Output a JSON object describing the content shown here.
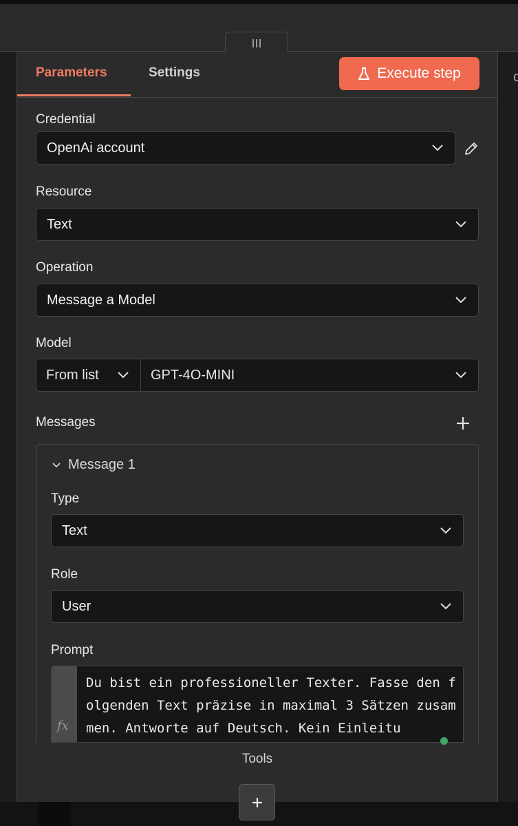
{
  "tabs": {
    "parameters": "Parameters",
    "settings": "Settings"
  },
  "execute_button": "Execute step",
  "credential": {
    "label": "Credential",
    "value": "OpenAi account"
  },
  "resource": {
    "label": "Resource",
    "value": "Text"
  },
  "operation": {
    "label": "Operation",
    "value": "Message a Model"
  },
  "model": {
    "label": "Model",
    "mode": "From list",
    "value": "GPT-4O-MINI"
  },
  "messages": {
    "label": "Messages",
    "message1": {
      "title": "Message 1",
      "type": {
        "label": "Type",
        "value": "Text"
      },
      "role": {
        "label": "Role",
        "value": "User"
      },
      "prompt": {
        "label": "Prompt",
        "fx": "fx",
        "text": "Du bist ein professioneller Texter. Fasse den folgenden Text präzise in maximal 3 Sätzen zusammen. Antworte auf Deutsch. Kein Einleitu"
      }
    }
  },
  "tools_label": "Tools",
  "accent_color": "#f06a4f"
}
